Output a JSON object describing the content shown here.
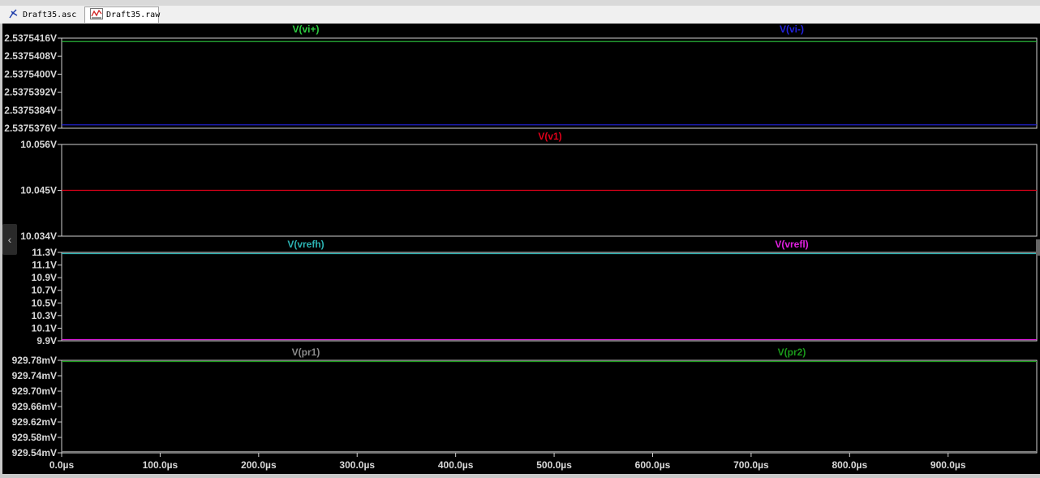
{
  "tabs": [
    {
      "label": "Draft35.asc",
      "icon": "schematic-icon"
    },
    {
      "label": "Draft35.raw",
      "icon": "waveform-icon"
    }
  ],
  "chart_data": [
    {
      "type": "line",
      "series": [
        {
          "name": "V(vi+)",
          "color": "#2ecc40",
          "x": [
            0,
            990
          ],
          "y": [
            2.5375415,
            2.5375415
          ]
        },
        {
          "name": "V(vi-)",
          "color": "#2222dd",
          "x": [
            0,
            990
          ],
          "y": [
            2.5375377,
            2.5375377
          ]
        }
      ],
      "yticks": [
        "2.5375416V",
        "2.5375408V",
        "2.5375400V",
        "2.5375392V",
        "2.5375384V",
        "2.5375376V"
      ],
      "ylim": [
        2.5375376,
        2.5375416
      ]
    },
    {
      "type": "line",
      "series": [
        {
          "name": "V(v1)",
          "color": "#e0001a",
          "x": [
            0,
            990
          ],
          "y": [
            10.045,
            10.045
          ]
        }
      ],
      "yticks": [
        "10.056V",
        "10.045V",
        "10.034V"
      ],
      "ylim": [
        10.034,
        10.056
      ]
    },
    {
      "type": "line",
      "series": [
        {
          "name": "V(vrefh)",
          "color": "#2cb3b3",
          "x": [
            0,
            990
          ],
          "y": [
            11.3,
            11.3
          ]
        },
        {
          "name": "V(vrefl)",
          "color": "#e020e0",
          "x": [
            0,
            990
          ],
          "y": [
            9.9,
            9.9
          ]
        }
      ],
      "yticks": [
        "11.3V",
        "11.1V",
        "10.9V",
        "10.7V",
        "10.5V",
        "10.3V",
        "10.1V",
        "9.9V"
      ],
      "ylim": [
        9.9,
        11.3
      ]
    },
    {
      "type": "line",
      "series": [
        {
          "name": "V(pr1)",
          "color": "#8a8a8a",
          "x": [
            0,
            990
          ],
          "y": [
            929.54,
            929.54
          ]
        },
        {
          "name": "V(pr2)",
          "color": "#1a9a1a",
          "x": [
            0,
            990
          ],
          "y": [
            929.78,
            929.78
          ]
        }
      ],
      "yticks": [
        "929.78mV",
        "929.74mV",
        "929.70mV",
        "929.66mV",
        "929.62mV",
        "929.58mV",
        "929.54mV"
      ],
      "ylim": [
        929.54,
        929.78
      ]
    }
  ],
  "xaxis": {
    "ticks": [
      "0.0µs",
      "100.0µs",
      "200.0µs",
      "300.0µs",
      "400.0µs",
      "500.0µs",
      "600.0µs",
      "700.0µs",
      "800.0µs",
      "900.0µs"
    ],
    "values": [
      0,
      100,
      200,
      300,
      400,
      500,
      600,
      700,
      800,
      900
    ],
    "xlim": [
      0,
      990
    ]
  },
  "theme": {
    "axis_color": "#d0d0d0",
    "label_color": "#d8d8d8",
    "background": "#000000"
  }
}
